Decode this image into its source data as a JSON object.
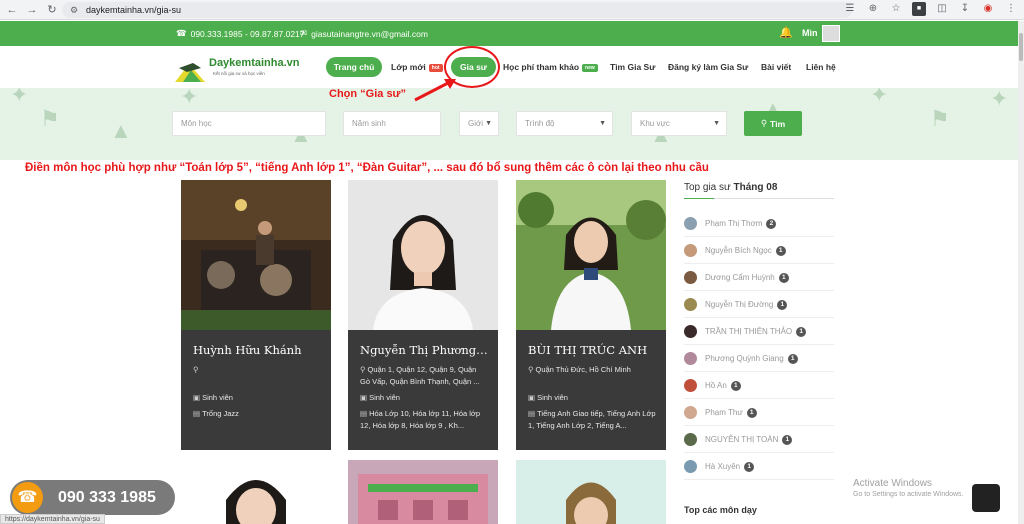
{
  "browser": {
    "url": "daykemtainha.vn/gia-su",
    "status_url": "https://daykemtainha.vn/gia-su"
  },
  "topbar": {
    "phone": "090.333.1985 - 09.87.87.0217",
    "email": "giasutainangtre.vn@gmail.com",
    "user": "Mìn"
  },
  "logo": {
    "name": "Daykemtainha.vn",
    "tagline": "Kết nối gia sư và học viên"
  },
  "nav": {
    "home": "Trang chủ",
    "new_classes": "Lớp mới",
    "new_badge": "hot",
    "tutors": "Gia sư",
    "fees": "Học phí tham khảo",
    "fees_badge": "new",
    "find_tutor": "Tìm Gia Sư",
    "register": "Đăng ký làm Gia Sư",
    "posts": "Bài viết",
    "contact": "Liên hệ"
  },
  "annotations": {
    "choose_tutor": "Chọn “Gia sư”",
    "instruction": "Điền môn học phù hợp như “Toán lớp 5”, “tiếng Anh lớp 1”, “Đàn Guitar”, ... sau đó bổ sung thêm các ô còn lại theo nhu cầu"
  },
  "search": {
    "subject_placeholder": "Môn học",
    "birth_year_placeholder": "Năm sinh",
    "gender": "Giới",
    "level": "Trình độ",
    "area": "Khu vực",
    "button": "Tìm"
  },
  "cards": [
    {
      "name": "Huỳnh Hữu Khánh",
      "location": "",
      "role": "Sinh viên",
      "subjects": "Trống Jazz"
    },
    {
      "name": "Nguyễn Thị Phương Th...",
      "location": "Quận 1, Quận 12, Quận 9, Quận Gò Vấp, Quận Bình Thạnh, Quận ...",
      "role": "Sinh viên",
      "subjects": "Hóa Lớp 10, Hóa lớp 11, Hóa lớp 12, Hóa lớp 8, Hóa lớp 9 , Kh..."
    },
    {
      "name": "BÙI THỊ TRÚC ANH",
      "location": "Quận Thủ Đức, Hồ Chí Minh",
      "role": "Sinh viên",
      "subjects": "Tiếng Anh Giao tiếp, Tiếng Anh Lớp 1, Tiếng Anh Lớp 2, Tiếng A..."
    }
  ],
  "sidebar": {
    "title_prefix": "Top gia sư ",
    "title_month": "Tháng 08",
    "items": [
      {
        "name": "Phạm Thị Thơm",
        "count": "2"
      },
      {
        "name": "Nguyễn Bích Ngọc",
        "count": "1"
      },
      {
        "name": "Dương Cẩm Huỳnh",
        "count": "1"
      },
      {
        "name": "Nguyễn Thị Đường",
        "count": "1"
      },
      {
        "name": "TRẦN THỊ THIÊN THẢO",
        "count": "1"
      },
      {
        "name": "Phương Quỳnh Giang",
        "count": "1"
      },
      {
        "name": "Hồ An",
        "count": "1"
      },
      {
        "name": "Phạm Thư",
        "count": "1"
      },
      {
        "name": "NGUYỄN THỊ TOÀN",
        "count": "1"
      },
      {
        "name": "Hà Xuyên",
        "count": "1"
      }
    ],
    "subjects_title": "Top các môn dạy"
  },
  "call": {
    "number": "090 333 1985"
  },
  "windows": {
    "activate_title": "Activate Windows",
    "activate_sub": "Go to Settings to activate Windows."
  },
  "colors": {
    "brand_green": "#4cae4c",
    "annotation_red": "#e8181a",
    "call_orange": "#f39c12"
  }
}
